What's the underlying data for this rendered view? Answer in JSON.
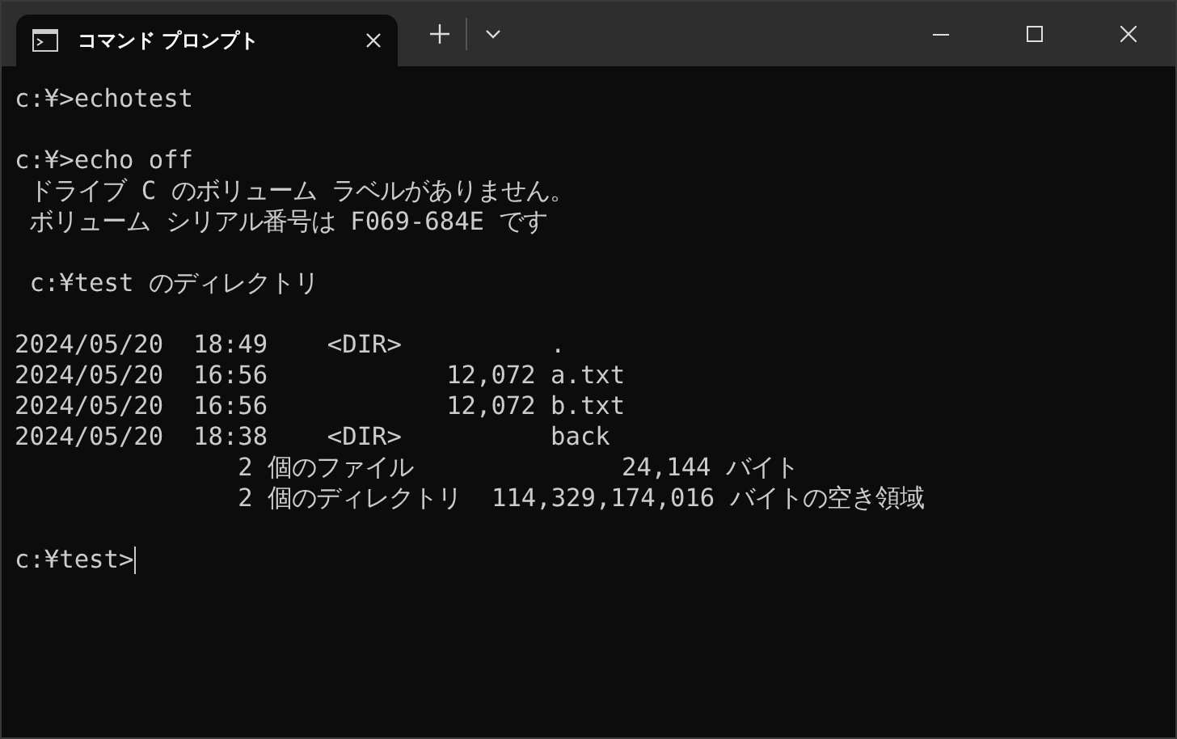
{
  "tab": {
    "title": "コマンド プロンプト",
    "selected": true
  },
  "terminal": {
    "blocks": [
      [
        "c:¥>echotest"
      ],
      [
        "c:¥>echo off",
        " ドライブ C のボリューム ラベルがありません。",
        " ボリューム シリアル番号は F069-684E です"
      ],
      [
        " c:¥test のディレクトリ"
      ],
      [
        "2024/05/20  18:49    <DIR>          .",
        "2024/05/20  16:56            12,072 a.txt",
        "2024/05/20  16:56            12,072 b.txt",
        "2024/05/20  18:38    <DIR>          back",
        "               2 個のファイル              24,144 バイト",
        "               2 個のディレクトリ  114,329,174,016 バイトの空き領域"
      ],
      [
        "c:¥test>"
      ]
    ]
  }
}
